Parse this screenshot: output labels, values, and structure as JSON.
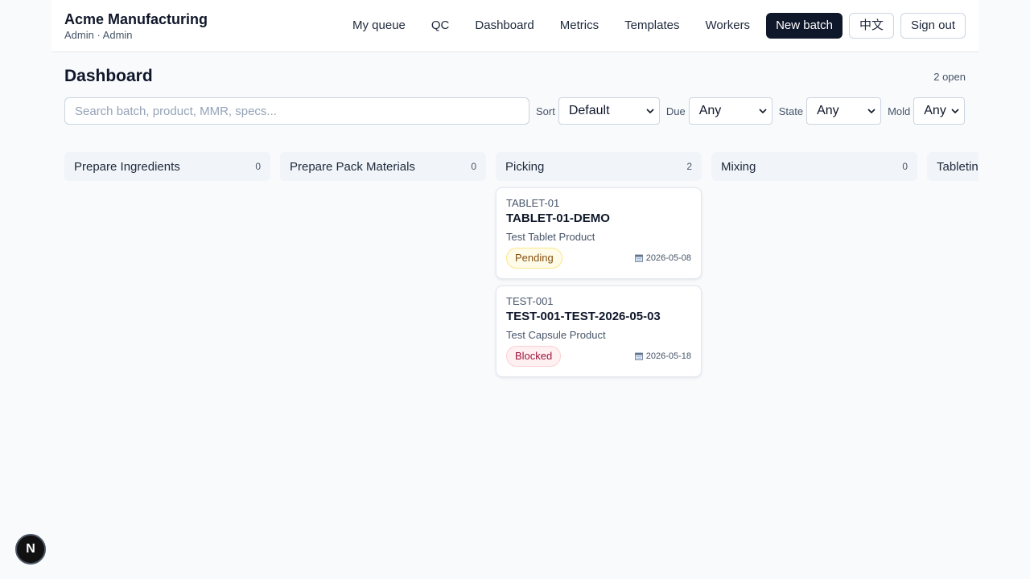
{
  "header": {
    "brand": "Acme Manufacturing",
    "user": "Admin · Admin",
    "nav": [
      "My queue",
      "QC",
      "Dashboard",
      "Metrics",
      "Templates",
      "Workers"
    ],
    "new_batch": "New batch",
    "lang": "中文",
    "sign_out": "Sign out"
  },
  "page": {
    "title": "Dashboard",
    "open_count": "2 open"
  },
  "filters": {
    "search_placeholder": "Search batch, product, MMR, specs...",
    "sort_label": "Sort",
    "sort_value": "Default",
    "due_label": "Due",
    "due_value": "Any",
    "state_label": "State",
    "state_value": "Any",
    "mold_label": "Mold",
    "mold_value": "Any"
  },
  "board": {
    "columns": [
      {
        "name": "Prepare Ingredients",
        "count": "0"
      },
      {
        "name": "Prepare Pack Materials",
        "count": "0"
      },
      {
        "name": "Picking",
        "count": "2"
      },
      {
        "name": "Mixing",
        "count": "0"
      },
      {
        "name": "Tabletin",
        "count": ""
      }
    ],
    "cards": [
      {
        "code": "TABLET-01",
        "title": "TABLET-01-DEMO",
        "product": "Test Tablet Product",
        "status": "Pending",
        "due": "2026-05-08"
      },
      {
        "code": "TEST-001",
        "title": "TEST-001-TEST-2026-05-03",
        "product": "Test Capsule Product",
        "status": "Blocked",
        "due": "2026-05-18"
      }
    ]
  },
  "floating": {
    "label": "N"
  },
  "colors": {
    "primary": "#0f172a",
    "pending_bg": "#fefce8",
    "blocked_bg": "#fff1f2",
    "column_bg": "#f1f5f9"
  },
  "icons": [
    "calendar-icon",
    "chevron-down-icon"
  ]
}
